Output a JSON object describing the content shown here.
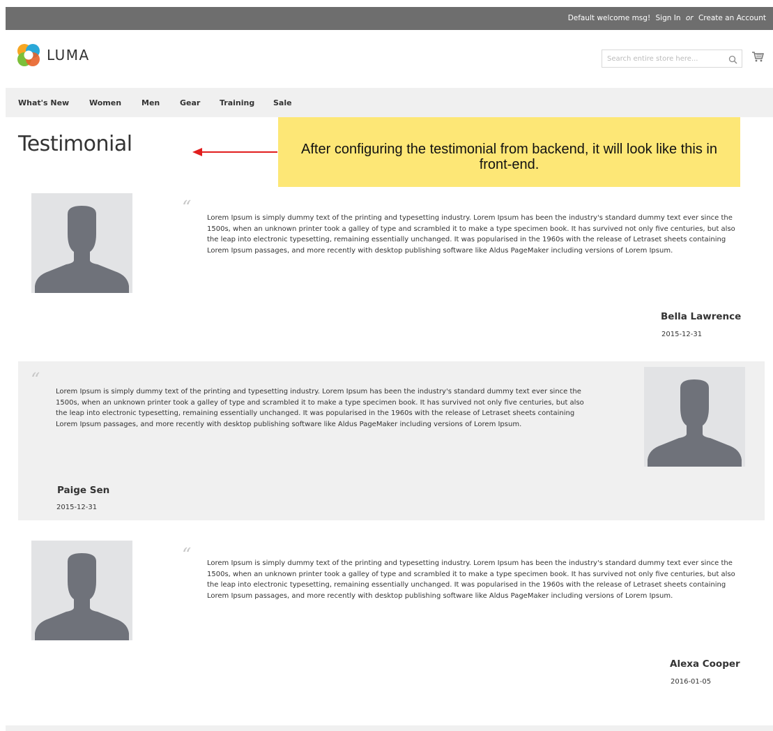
{
  "header": {
    "welcome": "Default welcome msg!",
    "sign_in": "Sign In",
    "or": "or",
    "create_account": "Create an Account"
  },
  "brand": {
    "name": "LUMA"
  },
  "search": {
    "placeholder": "Search entire store here...",
    "value": ""
  },
  "nav": {
    "items": [
      "What's New",
      "Women",
      "Men",
      "Gear",
      "Training",
      "Sale"
    ]
  },
  "page": {
    "title": "Testimonial"
  },
  "callout": {
    "text": "After configuring the testimonial from backend, it will look like this in front-end."
  },
  "testimonials": [
    {
      "quote": "Lorem Ipsum is simply dummy text of the printing and typesetting industry. Lorem Ipsum has been the industry's standard dummy text ever since the 1500s, when an unknown printer took a galley of type and scrambled it to make a type specimen book. It has survived not only five centuries, but also the leap into electronic typesetting, remaining essentially unchanged. It was popularised in the 1960s with the release of Letraset sheets containing Lorem Ipsum passages, and more recently with desktop publishing software like Aldus PageMaker including versions of Lorem Ipsum.",
      "name": "Bella Lawrence",
      "date": "2015-12-31"
    },
    {
      "quote": "Lorem Ipsum is simply dummy text of the printing and typesetting industry. Lorem Ipsum has been the industry's standard dummy text ever since the 1500s, when an unknown printer took a galley of type and scrambled it to make a type specimen book. It has survived not only five centuries, but also the leap into electronic typesetting, remaining essentially unchanged. It was popularised in the 1960s with the release of Letraset sheets containing Lorem Ipsum passages, and more recently with desktop publishing software like Aldus PageMaker including versions of Lorem Ipsum.",
      "name": "Paige Sen",
      "date": "2015-12-31"
    },
    {
      "quote": "Lorem Ipsum is simply dummy text of the printing and typesetting industry. Lorem Ipsum has been the industry's standard dummy text ever since the 1500s, when an unknown printer took a galley of type and scrambled it to make a type specimen book. It has survived not only five centuries, but also the leap into electronic typesetting, remaining essentially unchanged. It was popularised in the 1960s with the release of Letraset sheets containing Lorem Ipsum passages, and more recently with desktop publishing software like Aldus PageMaker including versions of Lorem Ipsum.",
      "name": "Alexa Cooper",
      "date": "2016-01-05"
    }
  ],
  "quote_glyph": "“",
  "colors": {
    "topbar": "#6e6e6e",
    "nav_bg": "#f0f0f0",
    "callout": "#fde776",
    "arrow": "#e11d1d",
    "avatar_bg": "#e2e3e5",
    "avatar_fg": "#6f727a"
  },
  "icons": {
    "logo": "luma-logo-icon",
    "search": "search-icon",
    "cart": "cart-icon",
    "avatar": "person-silhouette-icon",
    "arrow": "left-arrow-icon"
  }
}
